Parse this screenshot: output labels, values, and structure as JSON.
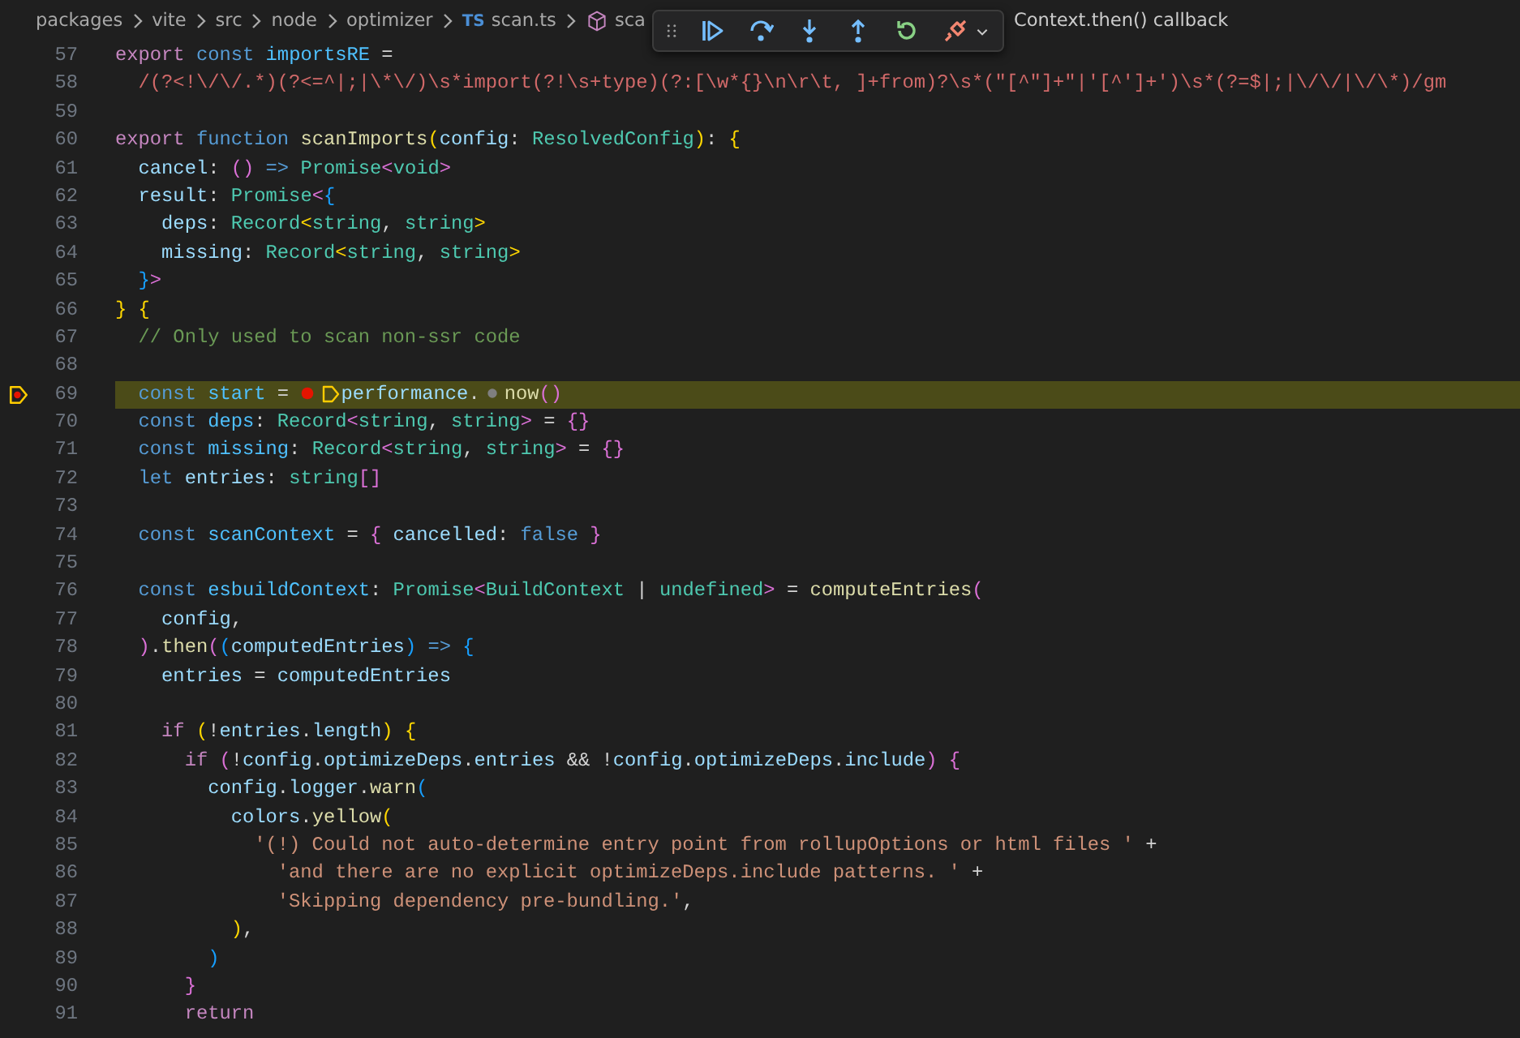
{
  "breadcrumbs": [
    {
      "label": "packages"
    },
    {
      "label": "vite"
    },
    {
      "label": "src"
    },
    {
      "label": "node"
    },
    {
      "label": "optimizer"
    },
    {
      "label": "scan.ts",
      "icon_text": "TS"
    },
    {
      "label": "sca",
      "kind": "symbol"
    }
  ],
  "debug_toolbar": {
    "buttons": [
      {
        "kind": "continue"
      },
      {
        "kind": "step-over"
      },
      {
        "kind": "step-into"
      },
      {
        "kind": "step-out"
      },
      {
        "kind": "restart"
      },
      {
        "kind": "disconnect"
      }
    ]
  },
  "call_frame": "Context.then() callback",
  "lines": [
    {
      "number": "57",
      "current": false,
      "tokens": [
        {
          "t": "export",
          "kind": "ctrl"
        },
        {
          "t": " const",
          "kind": "kw"
        },
        {
          "t": " importsRE",
          "kind": "const"
        },
        {
          "t": " ="
        }
      ]
    },
    {
      "number": "58",
      "current": false,
      "tokens": [
        {
          "t": "  /(?<!\\/\\/.*)(?<=^|;|\\*\\/)\\s*import(?!\\s+type)(?:[\\w*{}\\n\\r\\t, ]+from)?\\s*(\"[^\"]+\"|'[^']+')\\s*(?=$|;|\\/\\/|\\/\\*)/gm",
          "kind": "re"
        }
      ]
    },
    {
      "number": "59",
      "current": false
    },
    {
      "number": "60",
      "current": false,
      "tokens": [
        {
          "t": "export",
          "kind": "ctrl"
        },
        {
          "t": " function",
          "kind": "kw"
        },
        {
          "t": " scanImports",
          "kind": "fn"
        },
        {
          "t": "(",
          "kind": "b1"
        },
        {
          "t": "config",
          "kind": "var"
        },
        {
          "t": ": "
        },
        {
          "t": "ResolvedConfig",
          "kind": "type"
        },
        {
          "t": ")",
          "kind": "b1"
        },
        {
          "t": ": "
        },
        {
          "t": "{",
          "kind": "b1"
        }
      ]
    },
    {
      "number": "61",
      "current": false,
      "tokens": [
        {
          "t": "  cancel",
          "kind": "var"
        },
        {
          "t": ": "
        },
        {
          "t": "()",
          "kind": "b2"
        },
        {
          "t": " =>",
          "kind": "kw"
        },
        {
          "t": " Promise",
          "kind": "type"
        },
        {
          "t": "<",
          "kind": "b2"
        },
        {
          "t": "void",
          "kind": "type"
        },
        {
          "t": ">",
          "kind": "b2"
        }
      ]
    },
    {
      "number": "62",
      "current": false,
      "tokens": [
        {
          "t": "  result",
          "kind": "var"
        },
        {
          "t": ": "
        },
        {
          "t": "Promise",
          "kind": "type"
        },
        {
          "t": "<",
          "kind": "b2"
        },
        {
          "t": "{",
          "kind": "b3"
        }
      ]
    },
    {
      "number": "63",
      "current": false,
      "tokens": [
        {
          "t": "    deps",
          "kind": "var"
        },
        {
          "t": ": "
        },
        {
          "t": "Record",
          "kind": "type"
        },
        {
          "t": "<",
          "kind": "b1"
        },
        {
          "t": "string",
          "kind": "type"
        },
        {
          "t": ", "
        },
        {
          "t": "string",
          "kind": "type"
        },
        {
          "t": ">",
          "kind": "b1"
        }
      ]
    },
    {
      "number": "64",
      "current": false,
      "tokens": [
        {
          "t": "    missing",
          "kind": "var"
        },
        {
          "t": ": "
        },
        {
          "t": "Record",
          "kind": "type"
        },
        {
          "t": "<",
          "kind": "b1"
        },
        {
          "t": "string",
          "kind": "type"
        },
        {
          "t": ", "
        },
        {
          "t": "string",
          "kind": "type"
        },
        {
          "t": ">",
          "kind": "b1"
        }
      ]
    },
    {
      "number": "65",
      "current": false,
      "tokens": [
        {
          "t": "  }",
          "kind": "b3"
        },
        {
          "t": ">",
          "kind": "b2"
        }
      ]
    },
    {
      "number": "66",
      "current": false,
      "tokens": [
        {
          "t": "}",
          "kind": "b1"
        },
        {
          "t": " {",
          "kind": "b1"
        }
      ]
    },
    {
      "number": "67",
      "current": false,
      "tokens": [
        {
          "t": "  // Only used to scan non-ssr code",
          "kind": "cm"
        }
      ]
    },
    {
      "number": "68",
      "current": false
    },
    {
      "number": "69",
      "current": true,
      "tokens": [
        {
          "t": "  const",
          "kind": "kw"
        },
        {
          "t": " start",
          "kind": "const"
        },
        {
          "t": " = "
        },
        {
          "kind": "breakpoint"
        },
        {
          "kind": "stop"
        },
        {
          "t": "performance",
          "kind": "var"
        },
        {
          "t": "."
        },
        {
          "kind": "hint"
        },
        {
          "t": "now",
          "kind": "fn"
        },
        {
          "t": "()",
          "kind": "b2"
        }
      ]
    },
    {
      "number": "70",
      "current": false,
      "tokens": [
        {
          "t": "  const",
          "kind": "kw"
        },
        {
          "t": " deps",
          "kind": "const"
        },
        {
          "t": ": "
        },
        {
          "t": "Record",
          "kind": "type"
        },
        {
          "t": "<",
          "kind": "b2"
        },
        {
          "t": "string",
          "kind": "type"
        },
        {
          "t": ", "
        },
        {
          "t": "string",
          "kind": "type"
        },
        {
          "t": ">",
          "kind": "b2"
        },
        {
          "t": " = "
        },
        {
          "t": "{}",
          "kind": "b2"
        }
      ]
    },
    {
      "number": "71",
      "current": false,
      "tokens": [
        {
          "t": "  const",
          "kind": "kw"
        },
        {
          "t": " missing",
          "kind": "const"
        },
        {
          "t": ": "
        },
        {
          "t": "Record",
          "kind": "type"
        },
        {
          "t": "<",
          "kind": "b2"
        },
        {
          "t": "string",
          "kind": "type"
        },
        {
          "t": ", "
        },
        {
          "t": "string",
          "kind": "type"
        },
        {
          "t": ">",
          "kind": "b2"
        },
        {
          "t": " = "
        },
        {
          "t": "{}",
          "kind": "b2"
        }
      ]
    },
    {
      "number": "72",
      "current": false,
      "tokens": [
        {
          "t": "  let",
          "kind": "kw"
        },
        {
          "t": " entries",
          "kind": "var"
        },
        {
          "t": ": "
        },
        {
          "t": "string",
          "kind": "type"
        },
        {
          "t": "[]",
          "kind": "b2"
        }
      ]
    },
    {
      "number": "73",
      "current": false
    },
    {
      "number": "74",
      "current": false,
      "tokens": [
        {
          "t": "  const",
          "kind": "kw"
        },
        {
          "t": " scanContext",
          "kind": "const"
        },
        {
          "t": " = "
        },
        {
          "t": "{",
          "kind": "b2"
        },
        {
          "t": " cancelled",
          "kind": "var"
        },
        {
          "t": ": "
        },
        {
          "t": "false",
          "kind": "kw"
        },
        {
          "t": " }",
          "kind": "b2"
        }
      ]
    },
    {
      "number": "75",
      "current": false
    },
    {
      "number": "76",
      "current": false,
      "tokens": [
        {
          "t": "  const",
          "kind": "kw"
        },
        {
          "t": " esbuildContext",
          "kind": "const"
        },
        {
          "t": ": "
        },
        {
          "t": "Promise",
          "kind": "type"
        },
        {
          "t": "<",
          "kind": "b2"
        },
        {
          "t": "BuildContext",
          "kind": "type"
        },
        {
          "t": " | "
        },
        {
          "t": "undefined",
          "kind": "type"
        },
        {
          "t": ">",
          "kind": "b2"
        },
        {
          "t": " = "
        },
        {
          "t": "computeEntries",
          "kind": "fn"
        },
        {
          "t": "(",
          "kind": "b2"
        }
      ]
    },
    {
      "number": "77",
      "current": false,
      "tokens": [
        {
          "t": "    config",
          "kind": "var"
        },
        {
          "t": ","
        }
      ]
    },
    {
      "number": "78",
      "current": false,
      "tokens": [
        {
          "t": "  )",
          "kind": "b2"
        },
        {
          "t": "."
        },
        {
          "t": "then",
          "kind": "fn"
        },
        {
          "t": "(",
          "kind": "b2"
        },
        {
          "t": "(",
          "kind": "b3"
        },
        {
          "t": "computedEntries",
          "kind": "var"
        },
        {
          "t": ")",
          "kind": "b3"
        },
        {
          "t": " =>",
          "kind": "kw"
        },
        {
          "t": " {",
          "kind": "b3"
        }
      ]
    },
    {
      "number": "79",
      "current": false,
      "tokens": [
        {
          "t": "    entries",
          "kind": "var"
        },
        {
          "t": " = "
        },
        {
          "t": "computedEntries",
          "kind": "var"
        }
      ]
    },
    {
      "number": "80",
      "current": false
    },
    {
      "number": "81",
      "current": false,
      "tokens": [
        {
          "t": "    if",
          "kind": "ctrl"
        },
        {
          "t": " (",
          "kind": "b1"
        },
        {
          "t": "!"
        },
        {
          "t": "entries",
          "kind": "var"
        },
        {
          "t": "."
        },
        {
          "t": "length",
          "kind": "var"
        },
        {
          "t": ")",
          "kind": "b1"
        },
        {
          "t": " {",
          "kind": "b1"
        }
      ]
    },
    {
      "number": "82",
      "current": false,
      "tokens": [
        {
          "t": "      if",
          "kind": "ctrl"
        },
        {
          "t": " (",
          "kind": "b2"
        },
        {
          "t": "!"
        },
        {
          "t": "config",
          "kind": "var"
        },
        {
          "t": "."
        },
        {
          "t": "optimizeDeps",
          "kind": "var"
        },
        {
          "t": "."
        },
        {
          "t": "entries",
          "kind": "var"
        },
        {
          "t": " && !"
        },
        {
          "t": "config",
          "kind": "var"
        },
        {
          "t": "."
        },
        {
          "t": "optimizeDeps",
          "kind": "var"
        },
        {
          "t": "."
        },
        {
          "t": "include",
          "kind": "var"
        },
        {
          "t": ")",
          "kind": "b2"
        },
        {
          "t": " {",
          "kind": "b2"
        }
      ]
    },
    {
      "number": "83",
      "current": false,
      "tokens": [
        {
          "t": "        config",
          "kind": "var"
        },
        {
          "t": "."
        },
        {
          "t": "logger",
          "kind": "var"
        },
        {
          "t": "."
        },
        {
          "t": "warn",
          "kind": "fn"
        },
        {
          "t": "(",
          "kind": "b3"
        }
      ]
    },
    {
      "number": "84",
      "current": false,
      "tokens": [
        {
          "t": "          colors",
          "kind": "var"
        },
        {
          "t": "."
        },
        {
          "t": "yellow",
          "kind": "fn"
        },
        {
          "t": "(",
          "kind": "b1"
        }
      ]
    },
    {
      "number": "85",
      "current": false,
      "tokens": [
        {
          "t": "            '(!) Could not auto-determine entry point from rollupOptions or html files '",
          "kind": "str"
        },
        {
          "t": " +"
        }
      ]
    },
    {
      "number": "86",
      "current": false,
      "tokens": [
        {
          "t": "              'and there are no explicit optimizeDeps.include patterns. '",
          "kind": "str"
        },
        {
          "t": " +"
        }
      ]
    },
    {
      "number": "87",
      "current": false,
      "tokens": [
        {
          "t": "              'Skipping dependency pre-bundling.'",
          "kind": "str"
        },
        {
          "t": ","
        }
      ]
    },
    {
      "number": "88",
      "current": false,
      "tokens": [
        {
          "t": "          )",
          "kind": "b1"
        },
        {
          "t": ","
        }
      ]
    },
    {
      "number": "89",
      "current": false,
      "tokens": [
        {
          "t": "        )",
          "kind": "b3"
        }
      ]
    },
    {
      "number": "90",
      "current": false,
      "tokens": [
        {
          "t": "      }",
          "kind": "b2"
        }
      ]
    },
    {
      "number": "91",
      "current": false,
      "tokens": [
        {
          "t": "      return",
          "kind": "ctrl"
        }
      ]
    }
  ]
}
